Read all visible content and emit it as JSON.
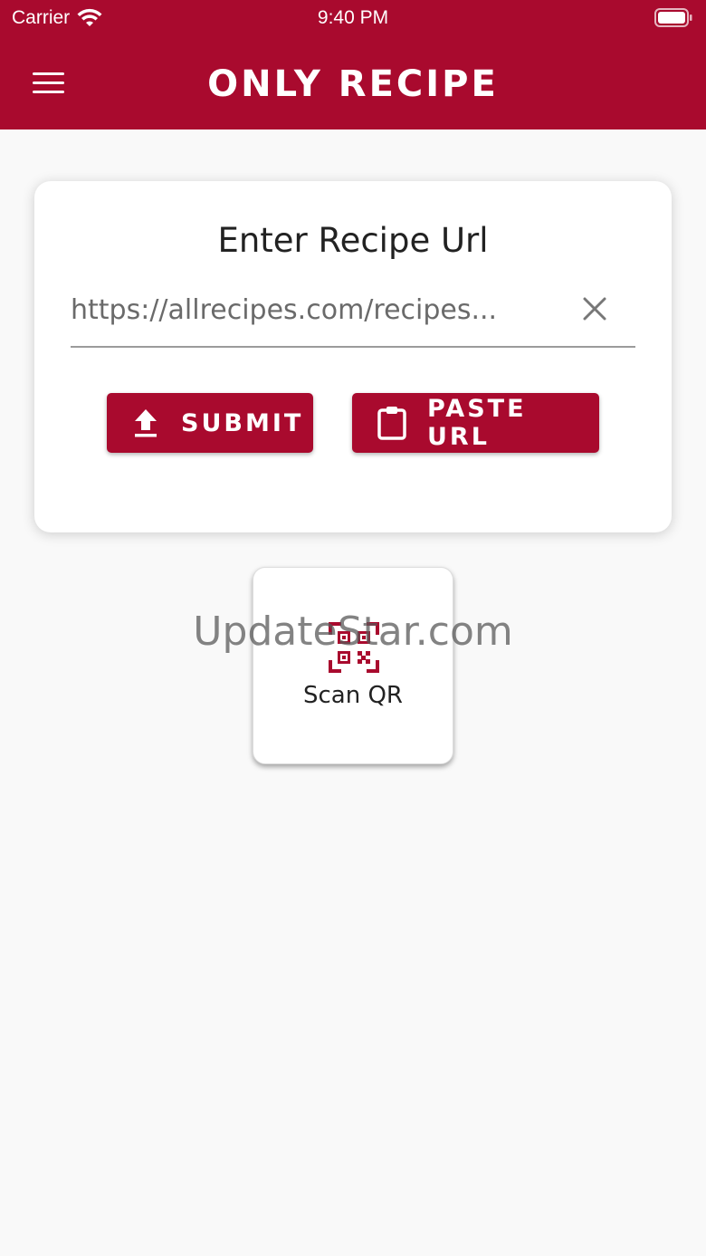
{
  "status_bar": {
    "carrier": "Carrier",
    "time": "9:40 PM"
  },
  "header": {
    "title": "ONLY RECIPE",
    "menu_icon": "hamburger-menu-icon"
  },
  "card": {
    "title": "Enter Recipe Url",
    "url_input_value": "https://allrecipes.com/recipes...",
    "submit_label": "SUBMIT",
    "paste_label": "PASTE URL"
  },
  "scan": {
    "label": "Scan QR"
  },
  "watermark": "UpdateStar.com",
  "colors": {
    "brand": "#a90a2e",
    "background": "#f9f9f9"
  }
}
